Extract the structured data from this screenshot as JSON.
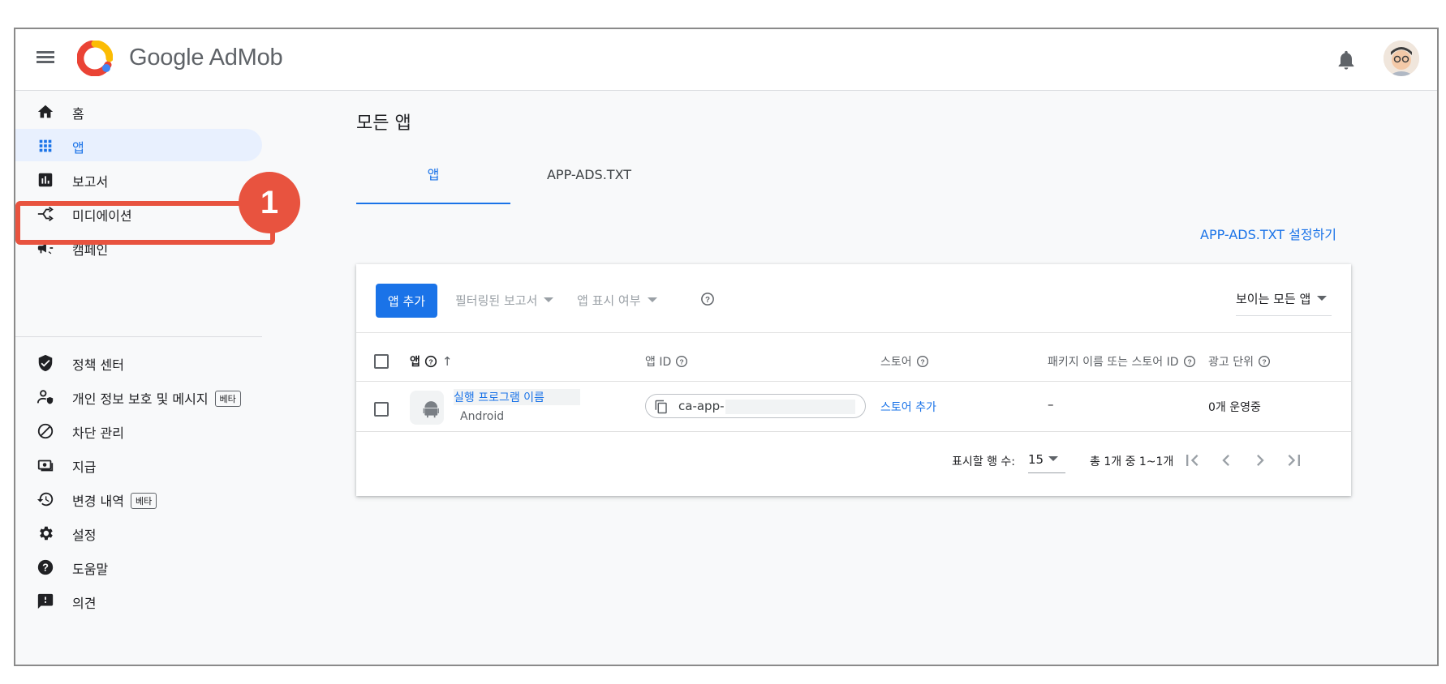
{
  "header": {
    "brand": "Google AdMob",
    "icons": {
      "menu": "menu-icon",
      "logo": "admob-logo",
      "notifications": "bell-icon",
      "avatar": "user-avatar"
    }
  },
  "sidebar": {
    "items": [
      {
        "label": "홈",
        "icon": "home-icon",
        "active": false,
        "beta": ""
      },
      {
        "label": "앱",
        "icon": "apps-grid-icon",
        "active": true,
        "beta": ""
      },
      {
        "label": "보고서",
        "icon": "bar-chart-icon",
        "active": false,
        "beta": ""
      },
      {
        "label": "미디에이션",
        "icon": "mediation-icon",
        "active": false,
        "beta": ""
      },
      {
        "label": "캠페인",
        "icon": "megaphone-icon",
        "active": false,
        "beta": ""
      },
      {
        "label": "정책 센터",
        "icon": "shield-icon",
        "active": false,
        "beta": ""
      },
      {
        "label": "개인 정보 보호 및 메시지",
        "icon": "privacy-icon",
        "active": false,
        "beta": "베타"
      },
      {
        "label": "차단 관리",
        "icon": "block-icon",
        "active": false,
        "beta": ""
      },
      {
        "label": "지급",
        "icon": "payments-icon",
        "active": false,
        "beta": ""
      },
      {
        "label": "변경 내역",
        "icon": "history-icon",
        "active": false,
        "beta": "베타"
      },
      {
        "label": "설정",
        "icon": "gear-icon",
        "active": false,
        "beta": ""
      },
      {
        "label": "도움말",
        "icon": "help-icon",
        "active": false,
        "beta": ""
      },
      {
        "label": "의견",
        "icon": "feedback-icon",
        "active": false,
        "beta": ""
      }
    ]
  },
  "annotation": {
    "badge": "1",
    "color": "#e8533f"
  },
  "main": {
    "title": "모든 앱",
    "tabs": [
      {
        "label": "앱",
        "active": true
      },
      {
        "label": "APP-ADS.TXT",
        "active": false
      }
    ],
    "setup_link": "APP-ADS.TXT 설정하기"
  },
  "toolbar": {
    "add_app": "앱 추가",
    "filter_reports": "필터링된 보고서",
    "app_visibility": "앱 표시 여부",
    "visible_select": "보이는 모든 앱"
  },
  "table": {
    "columns": [
      "앱",
      "앱 ID",
      "스토어",
      "패키지 이름 또는 스토어 ID",
      "광고 단위"
    ],
    "rows": [
      {
        "platform_icon": "android-icon",
        "name": "실행 프로그램 이름",
        "platform": "Android",
        "app_id": "ca-app-",
        "store": "스토어 추가",
        "package": "–",
        "ad_units": "0개 운영중"
      }
    ]
  },
  "pagination": {
    "rows_label": "표시할 행 수:",
    "rows_per_page": "15",
    "range": "총 1개 중 1~1개"
  },
  "colors": {
    "accent": "#1a73e8",
    "annotation": "#e8533f",
    "background": "#f8f9fa"
  }
}
